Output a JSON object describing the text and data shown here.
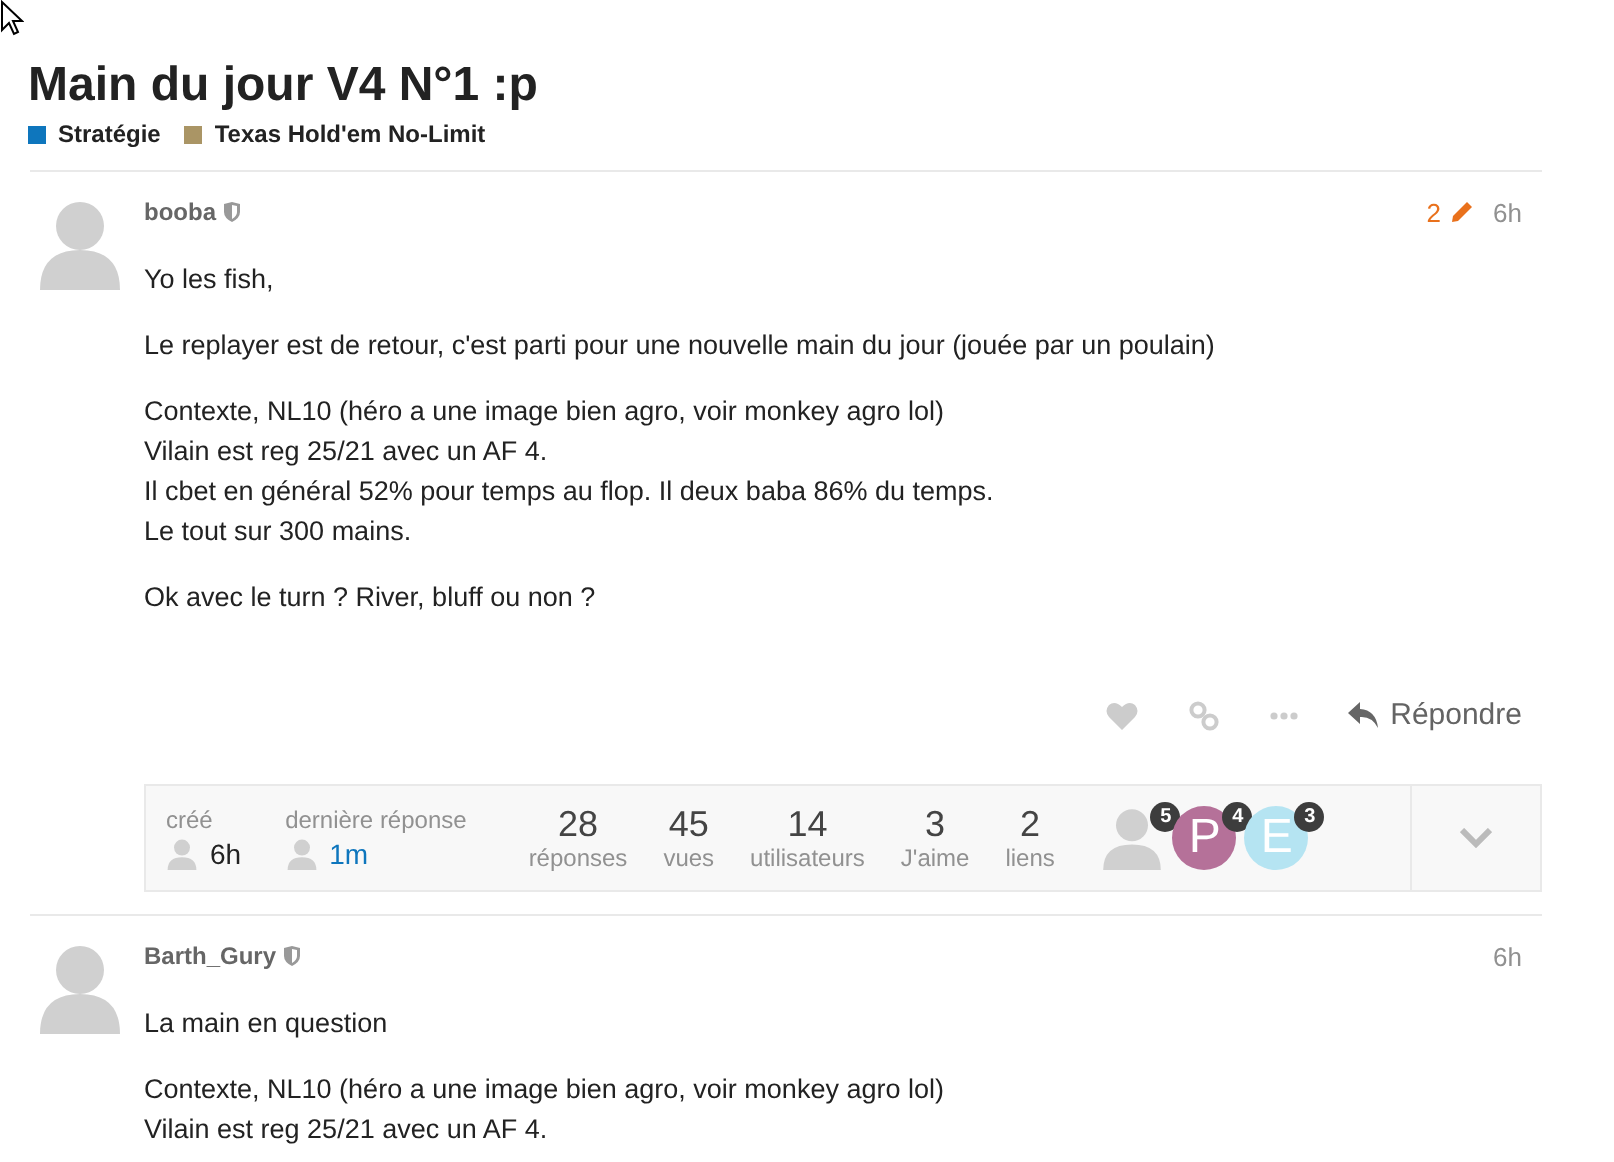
{
  "topic": {
    "title": "Main du jour V4 N°1 :p",
    "categories": [
      {
        "name": "Stratégie",
        "color": "#0e76bd"
      },
      {
        "name": "Texas Hold'em No-Limit",
        "color": "#aa9565"
      }
    ]
  },
  "posts": [
    {
      "username": "booba",
      "edits": "2",
      "time": "6h",
      "paragraphs": [
        "Yo les fish,",
        "Le replayer est de retour, c'est parti pour une nouvelle main du jour (jouée par un poulain)",
        "Contexte, NL10 (héro a une image bien agro, voir monkey agro lol)\nVilain est reg 25/21 avec un AF 4.\nIl cbet en général 52% pour temps au flop. Il deux baba 86% du temps.\nLe tout sur 300 mains.",
        "Ok avec le turn ? River, bluff ou non ?"
      ],
      "reply_label": "Répondre",
      "summary": {
        "created_label": "créé",
        "created_time": "6h",
        "last_label": "dernière réponse",
        "last_time": "1m",
        "stats": [
          {
            "value": "28",
            "label": "réponses"
          },
          {
            "value": "45",
            "label": "vues"
          },
          {
            "value": "14",
            "label": "utilisateurs"
          },
          {
            "value": "3",
            "label": "J'aime"
          },
          {
            "value": "2",
            "label": "liens"
          }
        ],
        "participants": [
          {
            "kind": "silhouette",
            "count": "5"
          },
          {
            "kind": "letter",
            "letter": "P",
            "color": "#b57199",
            "count": "4"
          },
          {
            "kind": "letter",
            "letter": "E",
            "color": "#b5e4f2",
            "count": "3"
          }
        ]
      }
    },
    {
      "username": "Barth_Gury",
      "time": "6h",
      "paragraphs": [
        "La main en question",
        "Contexte, NL10 (héro a une image bien agro, voir monkey agro lol)\nVilain est reg 25/21 avec un AF 4."
      ]
    }
  ]
}
